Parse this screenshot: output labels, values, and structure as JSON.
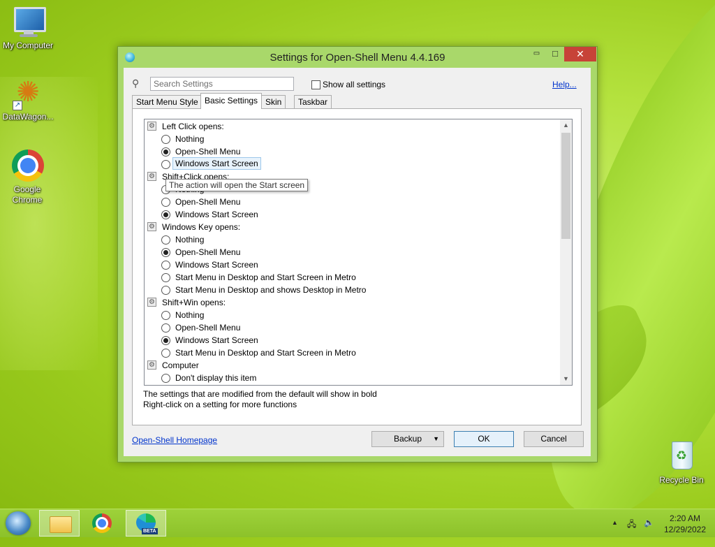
{
  "desktop": {
    "icons": [
      {
        "label": "My Computer"
      },
      {
        "label": "DataWagon..."
      },
      {
        "label": "Google Chrome"
      },
      {
        "label": "Recycle Bin"
      }
    ]
  },
  "window": {
    "title": "Settings for Open-Shell Menu 4.4.169",
    "controls": {
      "minimize": "▭",
      "maximize": "□",
      "close": "✕"
    },
    "search": {
      "placeholder": "Search Settings",
      "value": ""
    },
    "show_all_label": "Show all settings",
    "show_all_checked": false,
    "help_label": "Help...",
    "tabs": [
      {
        "label": "Start Menu Style"
      },
      {
        "label": "Basic Settings",
        "active": true
      },
      {
        "label": "Skin"
      },
      {
        "label": "Taskbar"
      }
    ],
    "settings": [
      {
        "group": "Left Click opens:",
        "options": [
          {
            "label": "Nothing",
            "selected": false
          },
          {
            "label": "Open-Shell Menu",
            "selected": true
          },
          {
            "label": "Windows Start Screen",
            "selected": false,
            "focused": true
          }
        ]
      },
      {
        "group": "Shift+Click opens:",
        "options": [
          {
            "label": "Nothing",
            "selected": false
          },
          {
            "label": "Open-Shell Menu",
            "selected": false
          },
          {
            "label": "Windows Start Screen",
            "selected": true
          }
        ]
      },
      {
        "group": "Windows Key opens:",
        "options": [
          {
            "label": "Nothing",
            "selected": false
          },
          {
            "label": "Open-Shell Menu",
            "selected": true
          },
          {
            "label": "Windows Start Screen",
            "selected": false
          },
          {
            "label": "Start Menu in Desktop and Start Screen in Metro",
            "selected": false
          },
          {
            "label": "Start Menu in Desktop and shows Desktop in Metro",
            "selected": false
          }
        ]
      },
      {
        "group": "Shift+Win opens:",
        "options": [
          {
            "label": "Nothing",
            "selected": false
          },
          {
            "label": "Open-Shell Menu",
            "selected": false
          },
          {
            "label": "Windows Start Screen",
            "selected": true
          },
          {
            "label": "Start Menu in Desktop and Start Screen in Metro",
            "selected": false
          }
        ]
      },
      {
        "group": "Computer",
        "options": [
          {
            "label": "Don't display this item",
            "selected": false
          }
        ]
      }
    ],
    "tooltip": "The action will open the Start screen",
    "notes": [
      "The settings that are modified from the default will show in bold",
      "Right-click on a setting for more functions"
    ],
    "homepage_link": "Open-Shell Homepage",
    "buttons": {
      "backup": "Backup",
      "ok": "OK",
      "cancel": "Cancel"
    }
  },
  "taskbar": {
    "items": [
      {
        "icon": "file-explorer-icon",
        "active": true
      },
      {
        "icon": "chrome-icon",
        "active": false
      },
      {
        "icon": "edge-beta-icon",
        "active": true,
        "badge": "BETA"
      }
    ],
    "clock": {
      "time": "2:20 AM",
      "date": "12/29/2022"
    }
  },
  "colors": {
    "close_button": "#c74338",
    "link": "#0033cc",
    "window_frame": "#a9d86a"
  }
}
